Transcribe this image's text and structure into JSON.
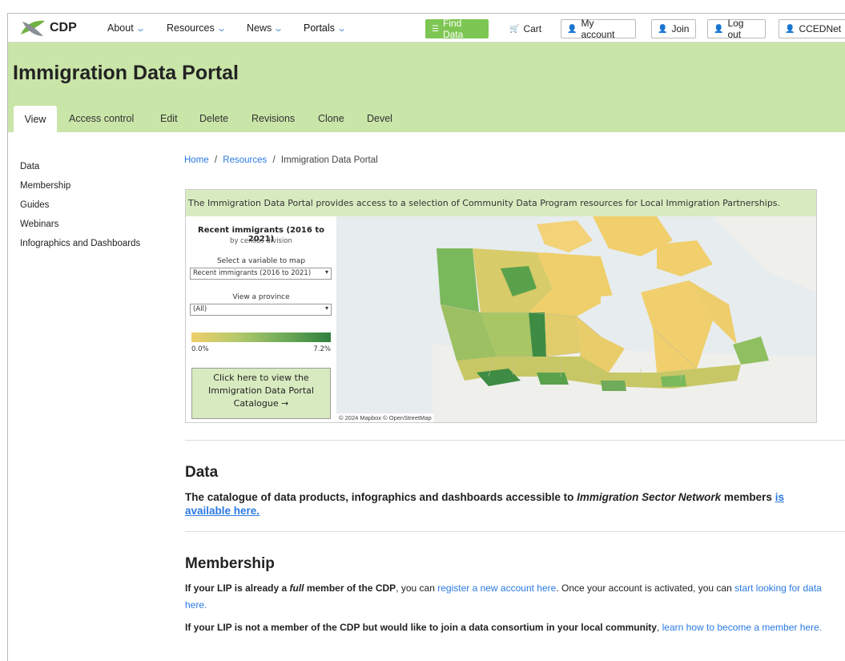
{
  "nav": {
    "logo_text": "CDP",
    "about": "About",
    "resources": "Resources",
    "news": "News",
    "portals": "Portals",
    "find_data": "Find Data",
    "cart": "Cart",
    "my_account": "My account",
    "join": "Join",
    "log_out": "Log out",
    "user": "CCEDNet"
  },
  "page": {
    "title": "Immigration Data Portal",
    "tabs": [
      "View",
      "Access control",
      "Edit",
      "Delete",
      "Revisions",
      "Clone",
      "Devel"
    ]
  },
  "sidebar": {
    "items": [
      "Data",
      "Membership",
      "Guides",
      "Webinars",
      "Infographics and Dashboards"
    ]
  },
  "breadcrumb": {
    "home": "Home",
    "sep": "/",
    "resources": "Resources",
    "current": "Immigration Data Portal"
  },
  "dashboard": {
    "banner": "The Immigration Data Portal provides access to a selection of Community Data Program resources for Local Immigration Partnerships.",
    "map_title": "Recent immigrants (2016 to 2021)",
    "map_subtitle": "by census division",
    "variable_label": "Select a variable to map",
    "variable_value": "Recent immigrants (2016 to 2021)",
    "province_label": "View a province",
    "province_value": "(All)",
    "legend_min": "0.0%",
    "legend_max": "7.2%",
    "catalogue_btn": "Click here to view the Immigration Data Portal Catalogue →",
    "credit": "© 2024 Mapbox  © OpenStreetMap",
    "colors": {
      "low": "#f0cf6c",
      "mid": "#8cbc5f",
      "high": "#2f7f3e"
    }
  },
  "data_section": {
    "heading": "Data",
    "text_before": "The catalogue of data products, infographics and dashboards accessible to ",
    "text_italic": "Immigration Sector Network",
    "text_after": " members ",
    "link": "is available here."
  },
  "membership_section": {
    "heading": "Membership",
    "p1_bold_a": "If your LIP is already a ",
    "p1_bold_italic": "full",
    "p1_bold_b": " member of the CDP",
    "p1_text_a": ", you can ",
    "p1_link_a": "register a new account here",
    "p1_text_b": ". Once your account is activated, you can ",
    "p1_link_b": "start looking for data here.",
    "p2_bold": "If your LIP is not a member of the CDP but would like to join a data consortium in your local community",
    "p2_text": ", ",
    "p2_link": "learn how to become a member here."
  }
}
